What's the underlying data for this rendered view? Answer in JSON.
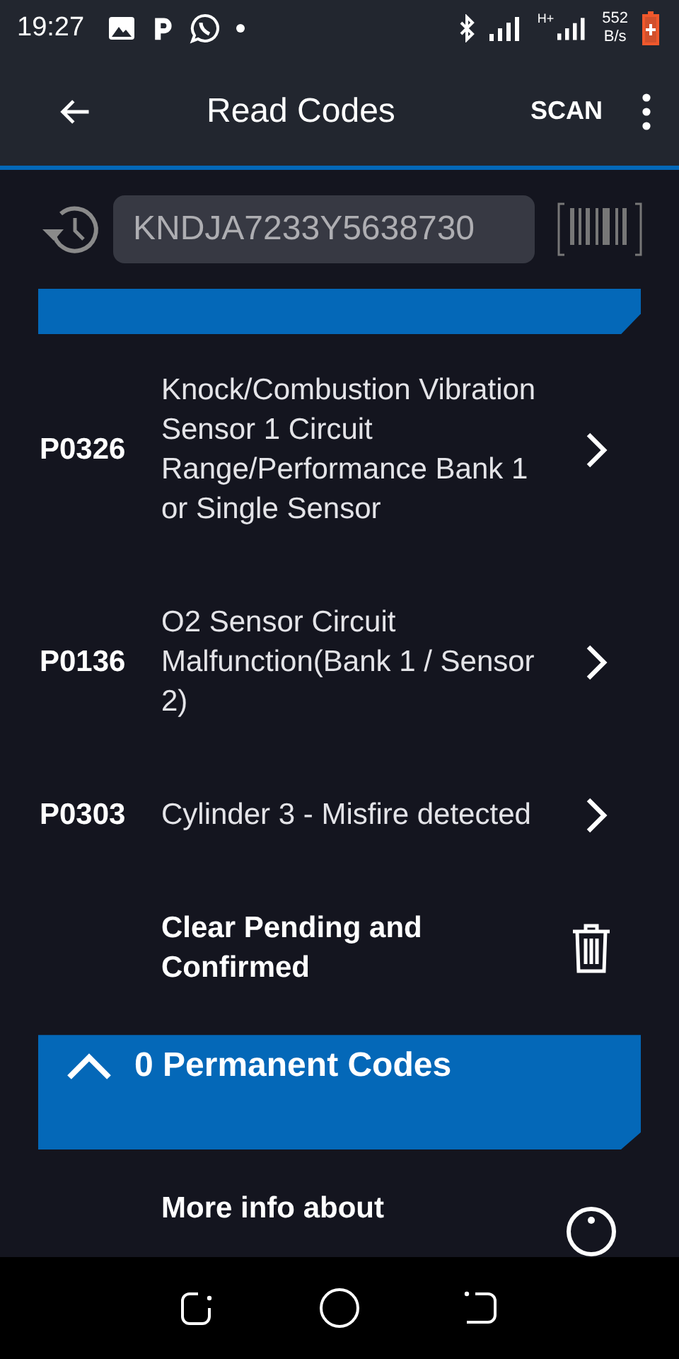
{
  "status_bar": {
    "time": "19:27",
    "net_speed_value": "552",
    "net_speed_unit": "B/s",
    "network_type": "H+"
  },
  "app_bar": {
    "title": "Read Codes",
    "action": "SCAN"
  },
  "vin_field": {
    "value": "KNDJA7233Y5638730"
  },
  "codes": [
    {
      "code": "P0326",
      "description": "Knock/Combustion Vibration Sensor  1 Circuit Range/Performance Bank 1 or Single Sensor"
    },
    {
      "code": "P0136",
      "description": "O2 Sensor Circuit Malfunction(Bank 1 / Sensor 2)"
    },
    {
      "code": "P0303",
      "description": "Cylinder 3 - Misfire detected"
    }
  ],
  "clear_action": {
    "label": "Clear Pending and Confirmed"
  },
  "permanent_section": {
    "title": "0 Permanent Codes",
    "expanded": true
  },
  "more_info": {
    "label": "More info about"
  }
}
